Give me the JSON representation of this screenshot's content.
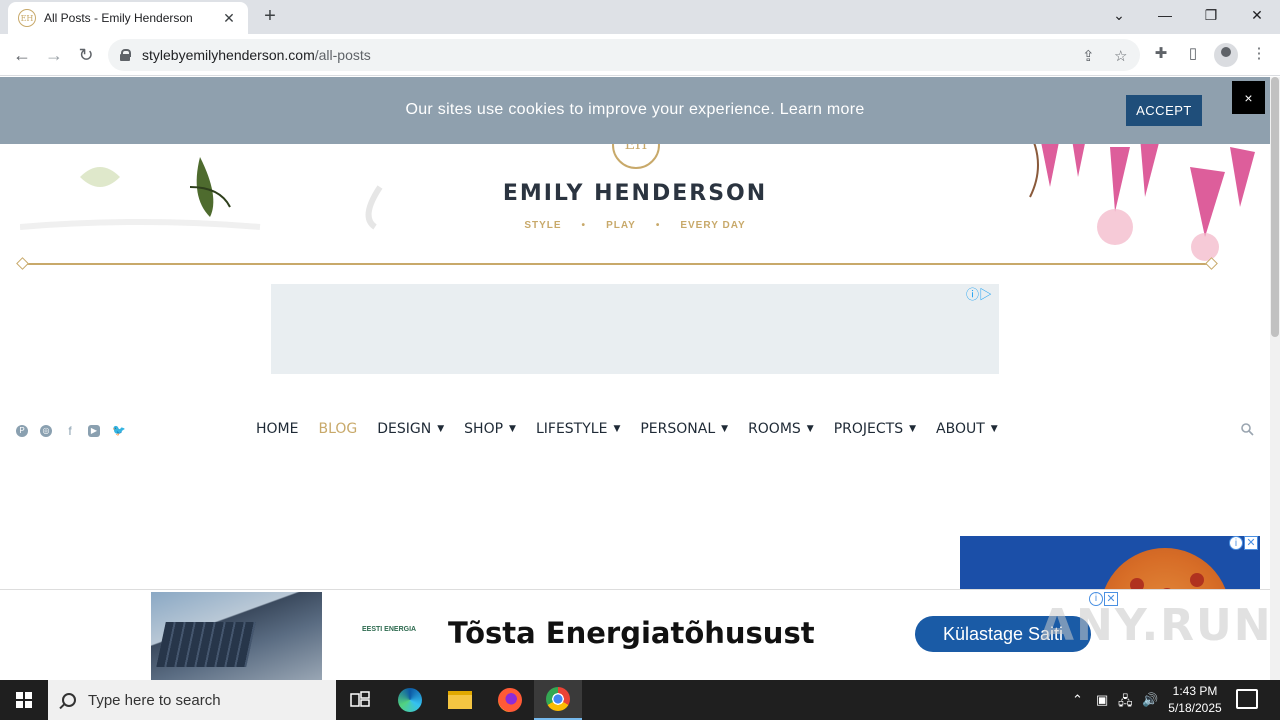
{
  "browser": {
    "tab_title": "All Posts - Emily Henderson",
    "tab_favicon_text": "EH",
    "url_domain": "stylebyemilyhenderson.com",
    "url_path": "/all-posts"
  },
  "cookie_banner": {
    "message": "Our sites use cookies to improve your experience. Learn more",
    "accept_label": "ACCEPT",
    "close_label": "×"
  },
  "site": {
    "monogram": "EH",
    "name": "EMILY HENDERSON",
    "tagline": [
      "STYLE",
      "•",
      "PLAY",
      "•",
      "EVERY DAY"
    ],
    "accent_color": "#c8a96a"
  },
  "nav": {
    "items": [
      {
        "label": "HOME",
        "has_dropdown": false,
        "active": false
      },
      {
        "label": "BLOG",
        "has_dropdown": false,
        "active": true
      },
      {
        "label": "DESIGN",
        "has_dropdown": true,
        "active": false
      },
      {
        "label": "SHOP",
        "has_dropdown": true,
        "active": false
      },
      {
        "label": "LIFESTYLE",
        "has_dropdown": true,
        "active": false
      },
      {
        "label": "PERSONAL",
        "has_dropdown": true,
        "active": false
      },
      {
        "label": "ROOMS",
        "has_dropdown": true,
        "active": false
      },
      {
        "label": "PROJECTS",
        "has_dropdown": true,
        "active": false
      },
      {
        "label": "ABOUT",
        "has_dropdown": true,
        "active": false
      }
    ],
    "caret": "▼",
    "social_icons": [
      "pinterest-icon",
      "instagram-icon",
      "facebook-icon",
      "youtube-icon",
      "twitter-icon"
    ]
  },
  "bottom_ad": {
    "brand": "EESTI ENERGIA",
    "headline": "Tõsta Energiatõhusust",
    "cta": "Külastage Saiti"
  },
  "watermark": "ANY.RUN",
  "taskbar": {
    "search_placeholder": "Type here to search",
    "time": "1:43 PM",
    "date": "5/18/2025"
  }
}
